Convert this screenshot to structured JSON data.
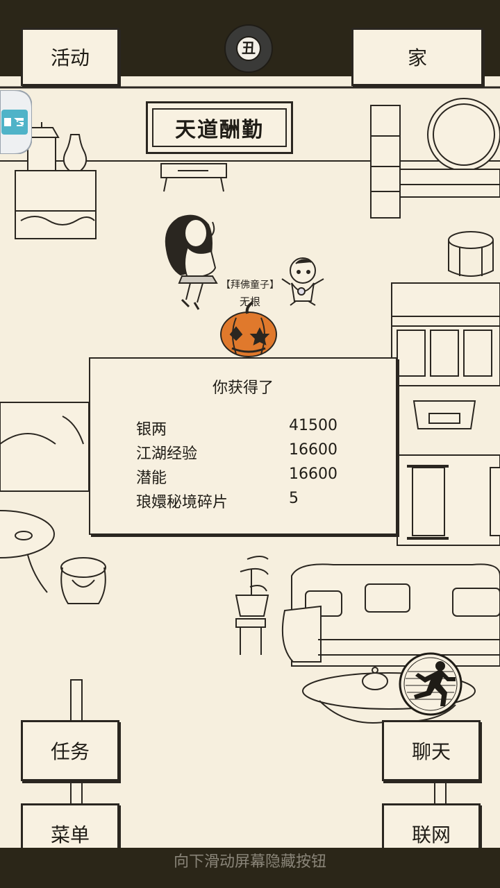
{
  "top": {
    "activity_label": "活动",
    "home_label": "家",
    "time_glyph": "丑"
  },
  "room": {
    "plaque_text": "天道酬勤",
    "npc_title": "【拜佛童子】",
    "npc_name": "无根"
  },
  "reward_dialog": {
    "title": "你获得了",
    "items": [
      {
        "name": "银两",
        "value": "41500"
      },
      {
        "name": "江湖经验",
        "value": "16600"
      },
      {
        "name": "潜能",
        "value": "16600"
      },
      {
        "name": "琅嬛秘境碎片",
        "value": "5"
      }
    ]
  },
  "bottom": {
    "task_label": "任务",
    "menu_label": "菜单",
    "chat_label": "聊天",
    "network_label": "联网",
    "hint": "向下滑动屏幕隐藏按钮"
  },
  "icons": {
    "time": "moon-clock-icon",
    "run": "running-man-icon",
    "side": "side-badge-icon"
  },
  "colors": {
    "background": "#f6efde",
    "frame": "#2b2618",
    "ink": "#2a2620",
    "pumpkin": "#e0792c"
  }
}
